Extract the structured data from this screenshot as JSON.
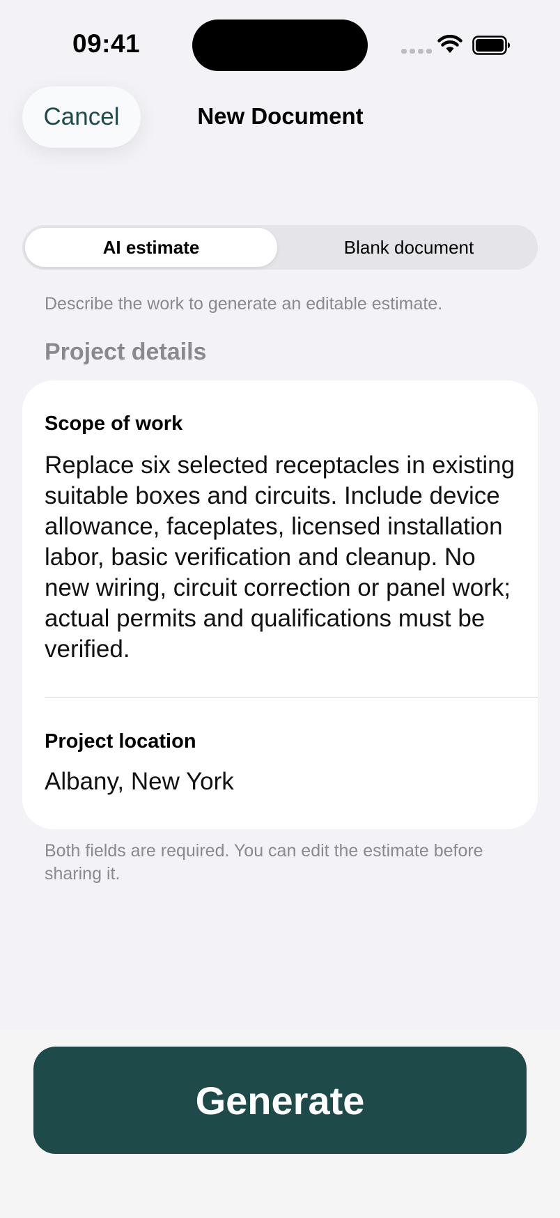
{
  "status_bar": {
    "time": "09:41"
  },
  "nav": {
    "cancel_label": "Cancel",
    "title": "New Document"
  },
  "segments": [
    {
      "label": "AI estimate",
      "selected": true
    },
    {
      "label": "Blank document",
      "selected": false
    }
  ],
  "hint": "Describe the work to generate an editable estimate.",
  "section_title": "Project details",
  "form": {
    "scope_label": "Scope of work",
    "scope_value": "Replace six selected receptacles in existing suitable boxes and circuits. Include device allowance, faceplates, licensed installation labor, basic verification and cleanup. No new wiring, circuit correction or panel work; actual permits and qualifications must be verified.",
    "location_label": "Project location",
    "location_value": "Albany, New York"
  },
  "footnote": "Both fields are required. You can edit the estimate before sharing it.",
  "generate_label": "Generate",
  "colors": {
    "accent": "#1f4a4a",
    "background": "#f2f2f7",
    "secondary_text": "#8a8a8e"
  }
}
